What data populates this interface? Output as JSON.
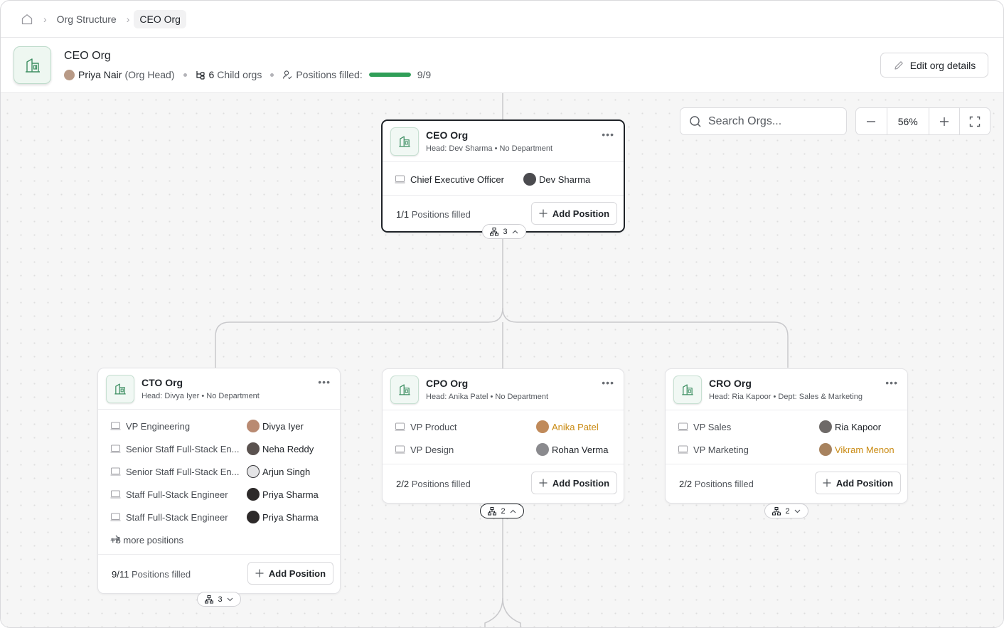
{
  "breadcrumb": {
    "items": [
      "Org Structure",
      "CEO Org"
    ]
  },
  "header": {
    "title": "CEO Org",
    "head_name": "Priya Nair",
    "head_role": "(Org Head)",
    "child_orgs_count": "6",
    "child_orgs_label": "Child orgs",
    "positions_label": "Positions filled:",
    "positions_value": "9/9",
    "positions_fraction": 1.0,
    "edit_button": "Edit org details"
  },
  "toolbar": {
    "search_placeholder": "Search Orgs...",
    "zoom_value": "56%"
  },
  "colors": {
    "accent_green": "#2f9e57",
    "pending_orange": "#c98a12"
  },
  "root": {
    "title": "CEO Org",
    "subtitle": "Head: Dev Sharma • No Department",
    "positions": [
      {
        "title": "Chief Executive Officer",
        "person": "Dev Sharma"
      }
    ],
    "filled_count": "1/1",
    "filled_label": "Positions filled",
    "add_label": "Add Position",
    "children_count": "3"
  },
  "orgs": [
    {
      "title": "CTO Org",
      "subtitle": "Head: Divya Iyer • No Department",
      "positions": [
        {
          "title": "VP Engineering",
          "person": "Divya Iyer"
        },
        {
          "title": "Senior Staff Full-Stack En...",
          "person": "Neha Reddy"
        },
        {
          "title": "Senior Staff Full-Stack En...",
          "person": "Arjun Singh"
        },
        {
          "title": "Staff Full-Stack Engineer",
          "person": "Priya Sharma"
        },
        {
          "title": "Staff Full-Stack Engineer",
          "person": "Priya Sharma"
        }
      ],
      "more_positions": "+6 more positions",
      "filled_count": "9/11",
      "filled_label": "Positions filled",
      "add_label": "Add Position",
      "children_count": "3"
    },
    {
      "title": "CPO Org",
      "subtitle": "Head: Anika Patel • No Department",
      "positions": [
        {
          "title": "VP Product",
          "person": "Anika Patel"
        },
        {
          "title": "VP Design",
          "person": "Rohan Verma"
        }
      ],
      "filled_count": "2/2",
      "filled_label": "Positions filled",
      "add_label": "Add Position",
      "children_count": "2"
    },
    {
      "title": "CRO Org",
      "subtitle": "Head: Ria Kapoor • Dept: Sales & Marketing",
      "positions": [
        {
          "title": "VP Sales",
          "person": "Ria Kapoor"
        },
        {
          "title": "VP Marketing",
          "person": "Vikram Menon"
        }
      ],
      "filled_count": "2/2",
      "filled_label": "Positions filled",
      "add_label": "Add Position",
      "children_count": "2"
    }
  ]
}
